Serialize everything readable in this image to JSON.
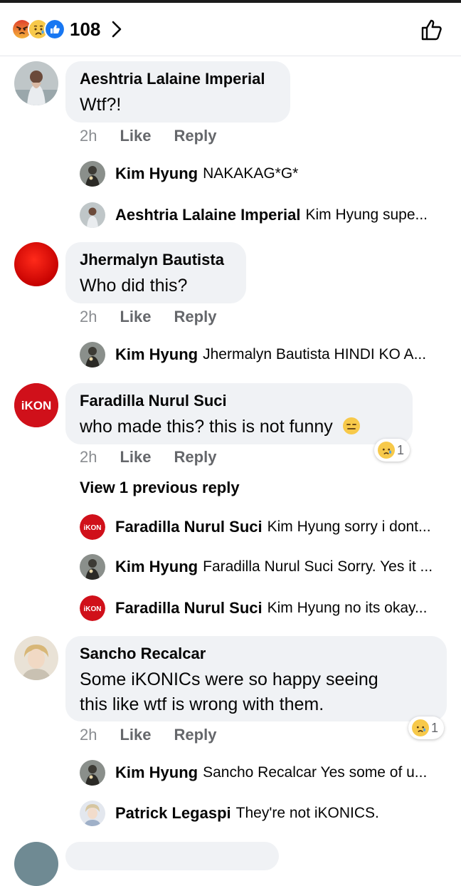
{
  "header": {
    "reaction_count": "108",
    "reaction_icons": [
      "angry-icon",
      "sad-icon",
      "like-icon"
    ]
  },
  "action_labels": {
    "like": "Like",
    "reply": "Reply"
  },
  "comments": [
    {
      "author": "Aeshtria Lalaine Imperial",
      "text": "Wtf?!",
      "time": "2h",
      "replies": [
        {
          "author": "Kim Hyung",
          "text": "NAKAKAG*G*"
        },
        {
          "author": "Aeshtria Lalaine Imperial",
          "text": "Kim Hyung supe..."
        }
      ]
    },
    {
      "author": "Jhermalyn Bautista",
      "text": "Who did this?",
      "time": "2h",
      "replies": [
        {
          "author": "Kim Hyung",
          "text": "Jhermalyn Bautista HINDI KO A..."
        }
      ]
    },
    {
      "author": "Faradilla Nurul Suci",
      "text": "who made this? this is not funny",
      "time": "2h",
      "reaction": {
        "icon": "sad-icon",
        "count": "1"
      },
      "view_previous": "View 1 previous reply",
      "avatar_text": "iKON",
      "replies": [
        {
          "author": "Faradilla Nurul Suci",
          "text": "Kim Hyung sorry i dont..."
        },
        {
          "author": "Kim Hyung",
          "text": "Faradilla Nurul Suci Sorry. Yes it ..."
        },
        {
          "author": "Faradilla Nurul Suci",
          "text": "Kim Hyung no its okay..."
        }
      ]
    },
    {
      "author": "Sancho Recalcar",
      "text_line1": "Some iKONICs were so happy seeing",
      "text_line2": "this like wtf is wrong with them.",
      "time": "2h",
      "reaction": {
        "icon": "sad-icon",
        "count": "1"
      },
      "replies": [
        {
          "author": "Kim Hyung",
          "text": "Sancho Recalcar Yes some of u..."
        },
        {
          "author": "Patrick Legaspi",
          "text": "They're not iKONICS."
        }
      ]
    }
  ],
  "colors": {
    "bubble": "#f0f2f5",
    "secondary_text": "#65676b",
    "like_blue": "#1877f2",
    "ikon_red": "#d0101a"
  }
}
